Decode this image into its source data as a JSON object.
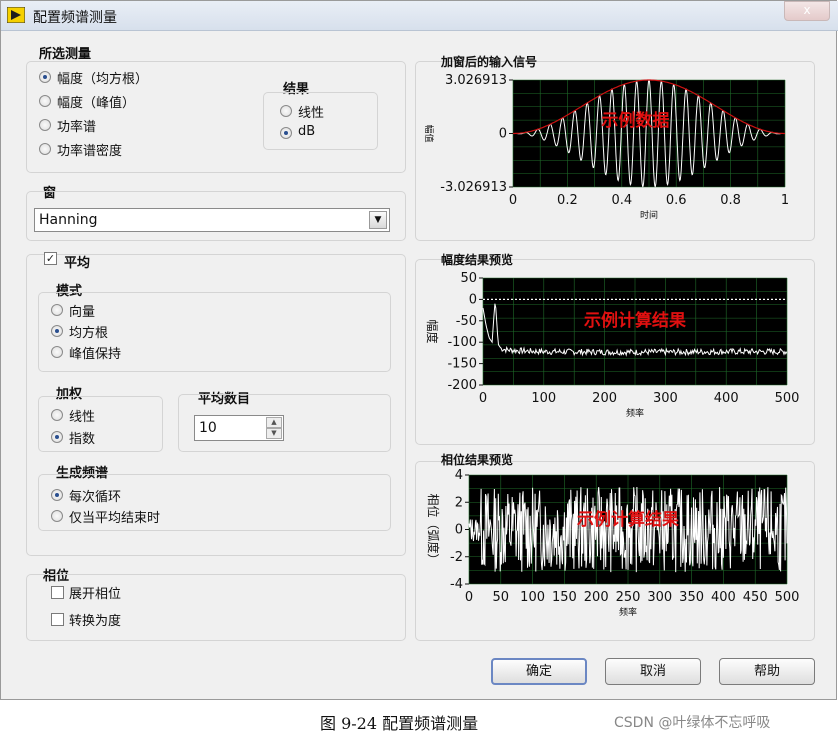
{
  "window": {
    "title": "配置频谱测量",
    "close_label": "x"
  },
  "measurement": {
    "title": "所选测量",
    "options": [
      "幅度（均方根）",
      "幅度（峰值）",
      "功率谱",
      "功率谱密度"
    ],
    "selected_index": 0
  },
  "result": {
    "title": "结果",
    "options": [
      "线性",
      "dB"
    ],
    "selected_index": 1
  },
  "window_section": {
    "title": "窗",
    "value": "Hanning"
  },
  "averaging": {
    "label": "平均",
    "checked": true,
    "mode": {
      "title": "模式",
      "options": [
        "向量",
        "均方根",
        "峰值保持"
      ],
      "selected_index": 1
    },
    "weighting": {
      "title": "加权",
      "options": [
        "线性",
        "指数"
      ],
      "selected_index": 1
    },
    "count": {
      "title": "平均数目",
      "value": "10"
    },
    "spectrum": {
      "title": "生成频谱",
      "options": [
        "每次循环",
        "仅当平均结束时"
      ],
      "selected_index": 0
    }
  },
  "phase": {
    "title": "相位",
    "options": [
      {
        "label": "展开相位",
        "checked": false
      },
      {
        "label": "转换为度",
        "checked": false
      }
    ]
  },
  "buttons": {
    "ok": "确定",
    "cancel": "取消",
    "help": "帮助"
  },
  "caption": "图 9-24 配置频谱测量",
  "watermark": "CSDN @叶绿体不忘呼吸",
  "colors": {
    "plot_bg": "#000000",
    "grid": "#1f6b2a",
    "trace": "#ffffff",
    "envelope": "#cc1111",
    "overlay_text": "#e01010"
  },
  "chart_data": [
    {
      "type": "line",
      "title": "加窗后的输入信号",
      "xlabel": "时间",
      "ylabel": "幅值",
      "overlay": "示例数据",
      "xlim": [
        0,
        1
      ],
      "ylim": [
        -3.026913,
        3.026913
      ],
      "x_ticks": [
        "0",
        "0.2",
        "0.4",
        "0.6",
        "0.8",
        "1"
      ],
      "y_ticks": [
        "3.026913",
        "0",
        "-3.026913"
      ],
      "y_tick_values": [
        3.026913,
        0,
        -3.026913
      ],
      "signal_cycles": 22,
      "peak": 3.026913
    },
    {
      "type": "line",
      "title": "幅度结果预览",
      "xlabel": "频率",
      "ylabel": "幅度",
      "overlay": "示例计算结果",
      "xlim": [
        0,
        500
      ],
      "ylim": [
        -200,
        50
      ],
      "x_ticks": [
        "0",
        "100",
        "200",
        "300",
        "400",
        "500"
      ],
      "y_ticks": [
        "50",
        "0",
        "-50",
        "-100",
        "-150",
        "-200"
      ],
      "y_tick_values": [
        50,
        0,
        -50,
        -100,
        -150,
        -200
      ],
      "points": [
        [
          0,
          -20
        ],
        [
          5,
          -60
        ],
        [
          10,
          -90
        ],
        [
          15,
          -100
        ],
        [
          18,
          -40
        ],
        [
          20,
          0
        ],
        [
          22,
          -40
        ],
        [
          25,
          -105
        ],
        [
          30,
          -115
        ],
        [
          40,
          -118
        ],
        [
          60,
          -120
        ],
        [
          100,
          -122
        ],
        [
          200,
          -123
        ],
        [
          300,
          -123
        ],
        [
          400,
          -122
        ],
        [
          500,
          -122
        ]
      ],
      "reference_line": 0
    },
    {
      "type": "line",
      "title": "相位结果预览",
      "xlabel": "频率",
      "ylabel": "相位（弧度）",
      "overlay": "示例计算结果",
      "xlim": [
        0,
        500
      ],
      "ylim": [
        -4,
        4
      ],
      "x_ticks": [
        "0",
        "50",
        "100",
        "150",
        "200",
        "250",
        "300",
        "350",
        "400",
        "450",
        "500"
      ],
      "y_ticks": [
        "4",
        "2",
        "0",
        "-2",
        "-4"
      ],
      "y_tick_values": [
        4,
        2,
        0,
        -2,
        -4
      ],
      "value_range": [
        -3.14,
        3.14
      ]
    }
  ]
}
